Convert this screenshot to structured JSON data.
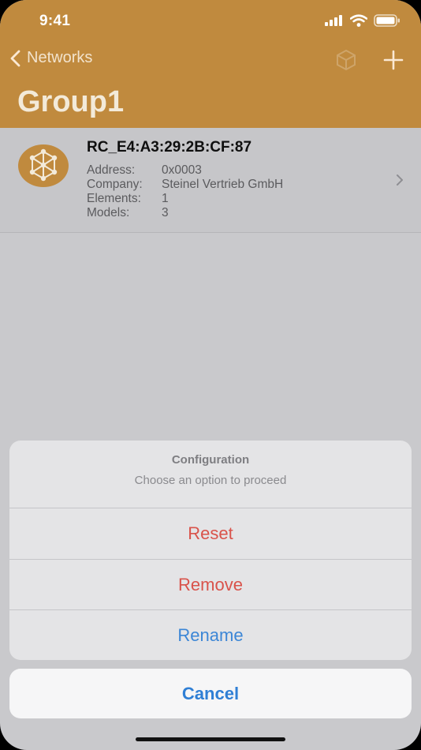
{
  "status_bar": {
    "time": "9:41",
    "icons": [
      "cellular-signal-icon",
      "wifi-icon",
      "battery-icon"
    ]
  },
  "nav": {
    "back_label": "Networks",
    "back_icon": "chevron-left-icon",
    "right_icons": [
      "box-icon",
      "plus-icon"
    ]
  },
  "page": {
    "title": "Group1"
  },
  "node": {
    "icon": "mesh-network-icon",
    "name": "RC_E4:A3:29:2B:CF:87",
    "details": [
      {
        "label": "Address:",
        "value": "0x0003"
      },
      {
        "label": "Company:",
        "value": "Steinel Vertrieb GmbH"
      },
      {
        "label": "Elements:",
        "value": "1"
      },
      {
        "label": "Models:",
        "value": "3"
      }
    ]
  },
  "action_sheet": {
    "title": "Configuration",
    "message": "Choose an option to proceed",
    "actions": [
      {
        "label": "Reset",
        "style": "destructive"
      },
      {
        "label": "Remove",
        "style": "destructive"
      },
      {
        "label": "Rename",
        "style": "default"
      }
    ],
    "cancel_label": "Cancel"
  },
  "colors": {
    "header": "#c08a3e",
    "destructive": "#d9534b",
    "action_blue": "#3c86d6",
    "avatar": "#c08a3e"
  }
}
